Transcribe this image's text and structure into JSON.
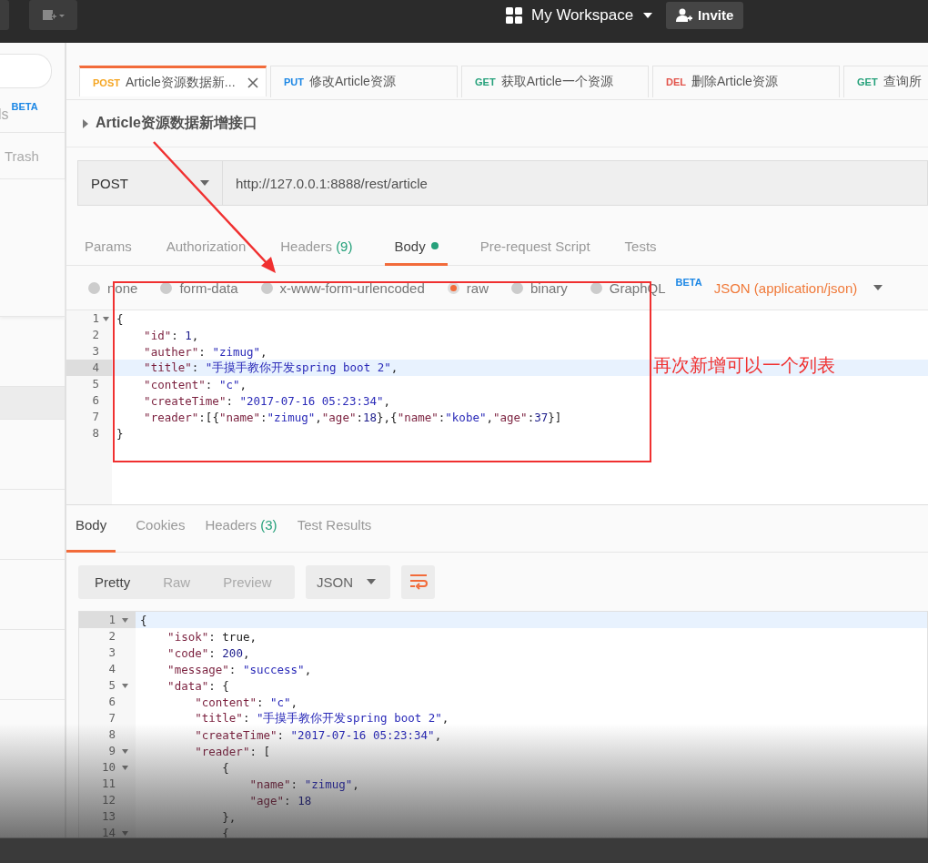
{
  "top_bar": {
    "workspace": "My Workspace",
    "invite": "Invite"
  },
  "sidebar": {
    "apis_label": "ls",
    "apis_badge": "BETA",
    "trash": "Trash",
    "rows": [
      {
        "selected": false
      },
      {
        "selected": true
      },
      {
        "selected": false
      },
      {
        "selected": false
      },
      {
        "selected": false
      },
      {
        "selected": false
      }
    ]
  },
  "tabs": [
    {
      "method": "POST",
      "color": "#f5a623",
      "label": "Article资源数据新...",
      "selected": true
    },
    {
      "method": "PUT",
      "color": "#1c87e5",
      "label": "修改Article资源",
      "selected": false
    },
    {
      "method": "GET",
      "color": "#26a17b",
      "label": "获取Article一个资源",
      "selected": false
    },
    {
      "method": "DEL",
      "color": "#e2534a",
      "label": "删除Article资源",
      "selected": false
    },
    {
      "method": "GET",
      "color": "#26a17b",
      "label": "查询所",
      "selected": false
    }
  ],
  "request": {
    "title": "Article资源数据新增接口",
    "method": "POST",
    "url": "http://127.0.0.1:8888/rest/article"
  },
  "request_tabs": [
    {
      "label": "Params",
      "selected": false
    },
    {
      "label": "Authorization",
      "selected": false
    },
    {
      "label": "Headers",
      "count": "(9)",
      "selected": false
    },
    {
      "label": "Body",
      "dot": true,
      "selected": true
    },
    {
      "label": "Pre-request Script",
      "selected": false
    },
    {
      "label": "Tests",
      "selected": false
    }
  ],
  "body_types": [
    {
      "label": "none",
      "selected": false
    },
    {
      "label": "form-data",
      "selected": false
    },
    {
      "label": "x-www-form-urlencoded",
      "selected": false
    },
    {
      "label": "raw",
      "selected": true
    },
    {
      "label": "binary",
      "selected": false
    },
    {
      "label": "GraphQL",
      "badge": "BETA",
      "selected": false
    }
  ],
  "content_type": "JSON (application/json)",
  "request_body": [
    {
      "number": "1",
      "fold": true,
      "highlighted": false,
      "text": "{"
    },
    {
      "number": "2",
      "fold": false,
      "highlighted": false,
      "text": "    \"id\": 1,"
    },
    {
      "number": "3",
      "fold": false,
      "highlighted": false,
      "text": "    \"auther\": \"zimug\","
    },
    {
      "number": "4",
      "fold": false,
      "highlighted": true,
      "text": "    \"title\": \"手摸手教你开发spring boot 2\","
    },
    {
      "number": "5",
      "fold": false,
      "highlighted": false,
      "text": "    \"content\": \"c\","
    },
    {
      "number": "6",
      "fold": false,
      "highlighted": false,
      "text": "    \"createTime\": \"2017-07-16 05:23:34\","
    },
    {
      "number": "7",
      "fold": false,
      "highlighted": false,
      "text": "    \"reader\":[{\"name\":\"zimug\",\"age\":18},{\"name\":\"kobe\",\"age\":37}]"
    },
    {
      "number": "8",
      "fold": false,
      "highlighted": false,
      "text": "}"
    }
  ],
  "annotation": {
    "note": "再次新增可以一个列表"
  },
  "response_tabs": [
    {
      "label": "Body",
      "selected": true
    },
    {
      "label": "Cookies",
      "selected": false
    },
    {
      "label": "Headers",
      "count": "(3)",
      "selected": false
    },
    {
      "label": "Test Results",
      "selected": false
    }
  ],
  "view_modes": [
    {
      "label": "Pretty",
      "selected": true
    },
    {
      "label": "Raw",
      "selected": false
    },
    {
      "label": "Preview",
      "selected": false
    }
  ],
  "response_format": "JSON",
  "response_body": [
    {
      "number": "1",
      "fold": true,
      "highlighted": true,
      "text": "{"
    },
    {
      "number": "2",
      "fold": false,
      "highlighted": false,
      "text": "    \"isok\": true,"
    },
    {
      "number": "3",
      "fold": false,
      "highlighted": false,
      "text": "    \"code\": 200,"
    },
    {
      "number": "4",
      "fold": false,
      "highlighted": false,
      "text": "    \"message\": \"success\","
    },
    {
      "number": "5",
      "fold": true,
      "highlighted": false,
      "text": "    \"data\": {"
    },
    {
      "number": "6",
      "fold": false,
      "highlighted": false,
      "text": "        \"content\": \"c\","
    },
    {
      "number": "7",
      "fold": false,
      "highlighted": false,
      "text": "        \"title\": \"手摸手教你开发spring boot 2\","
    },
    {
      "number": "8",
      "fold": false,
      "highlighted": false,
      "text": "        \"createTime\": \"2017-07-16 05:23:34\","
    },
    {
      "number": "9",
      "fold": true,
      "highlighted": false,
      "text": "        \"reader\": ["
    },
    {
      "number": "10",
      "fold": true,
      "highlighted": false,
      "text": "            {"
    },
    {
      "number": "11",
      "fold": false,
      "highlighted": false,
      "text": "                \"name\": \"zimug\","
    },
    {
      "number": "12",
      "fold": false,
      "highlighted": false,
      "text": "                \"age\": 18"
    },
    {
      "number": "13",
      "fold": false,
      "highlighted": false,
      "text": "            },"
    },
    {
      "number": "14",
      "fold": true,
      "highlighted": false,
      "text": "            {"
    }
  ]
}
